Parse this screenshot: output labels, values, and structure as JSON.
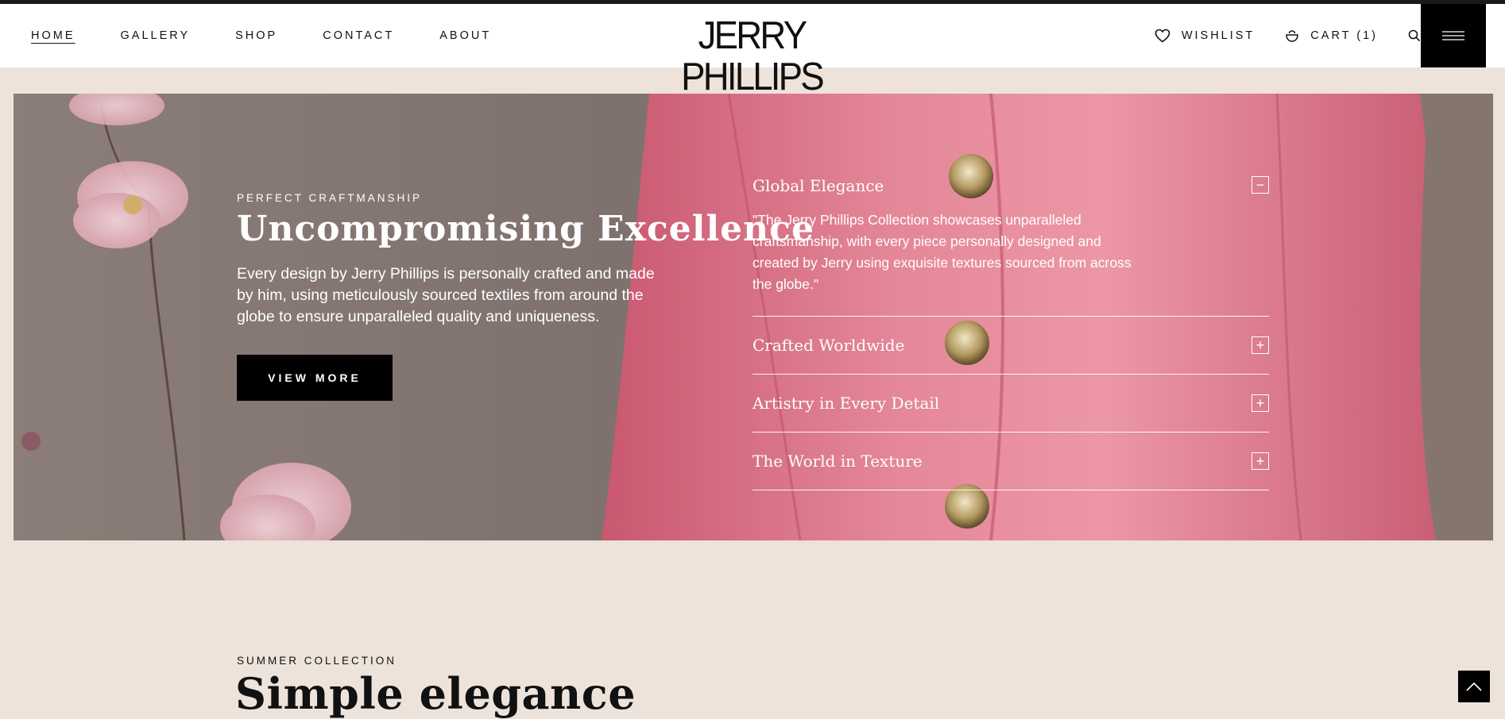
{
  "header": {
    "logo": "JERRY PHILLIPS",
    "nav": [
      {
        "label": "HOME",
        "active": true
      },
      {
        "label": "GALLERY"
      },
      {
        "label": "SHOP"
      },
      {
        "label": "CONTACT"
      },
      {
        "label": "ABOUT"
      }
    ],
    "wishlist_label": "WISHLIST",
    "cart_label": "CART (1)",
    "icons": {
      "wishlist": "heart-icon",
      "cart": "bag-icon",
      "search": "search-icon",
      "menu": "hamburger-icon"
    }
  },
  "hero": {
    "eyebrow": "PERFECT CRAFTMANSHIP",
    "title": "Uncompromising Excellence",
    "text": "Every design by Jerry Phillips is personally crafted and made by him, using meticulously sourced textiles from around the globe to ensure unparalleled quality and uniqueness.",
    "button": "VIEW MORE",
    "accordion": [
      {
        "title": "Global Elegance",
        "open": true,
        "toggle": "−",
        "body": "\"The Jerry Phillips Collection showcases unparalleled craftsmanship, with every piece personally designed and created by Jerry using exquisite textures sourced from across the globe.\""
      },
      {
        "title": "Crafted Worldwide",
        "open": false,
        "toggle": "+"
      },
      {
        "title": "Artistry in Every Detail",
        "open": false,
        "toggle": "+"
      },
      {
        "title": "The World in Texture",
        "open": false,
        "toggle": "+"
      }
    ]
  },
  "collection": {
    "eyebrow": "SUMMER COLLECTION",
    "title": "Simple elegance"
  },
  "colors": {
    "page_bg": "#ede3da",
    "header_bg": "#ffffff",
    "button_bg": "#000000",
    "jacket": "#e07a8e"
  }
}
